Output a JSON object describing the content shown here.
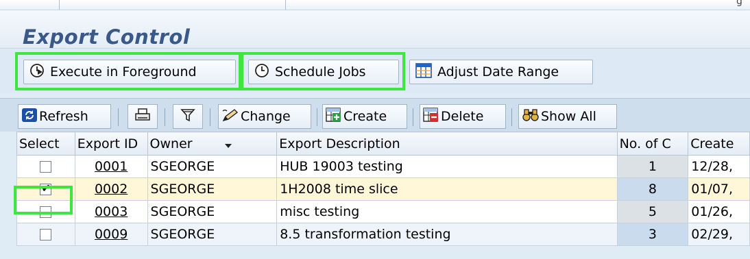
{
  "corner_text": "g",
  "title": "Export Control",
  "app_toolbar": {
    "execute_label": "Execute in Foreground",
    "schedule_label": "Schedule Jobs",
    "adjust_label": "Adjust Date Range"
  },
  "grid_toolbar": {
    "refresh_label": "Refresh",
    "change_label": "Change",
    "create_label": "Create",
    "delete_label": "Delete",
    "show_all_label": "Show All"
  },
  "table": {
    "headers": [
      "Select",
      "Export ID",
      "Owner",
      "Export Description",
      "No. of C",
      "Create"
    ],
    "rows": [
      {
        "selected": false,
        "id": "0001",
        "owner": "SGEORGE",
        "desc": "HUB 19003 testing",
        "count": "1",
        "created": "12/28,"
      },
      {
        "selected": true,
        "id": "0002",
        "owner": "SGEORGE",
        "desc": "1H2008 time slice",
        "count": "8",
        "created": "01/07,"
      },
      {
        "selected": false,
        "id": "0003",
        "owner": "SGEORGE",
        "desc": "misc testing",
        "count": "5",
        "created": "01/26,"
      },
      {
        "selected": false,
        "id": "0009",
        "owner": "SGEORGE",
        "desc": "8.5 transformation testing",
        "count": "3",
        "created": "02/29,"
      }
    ]
  },
  "highlight_color": "#3ee63e"
}
